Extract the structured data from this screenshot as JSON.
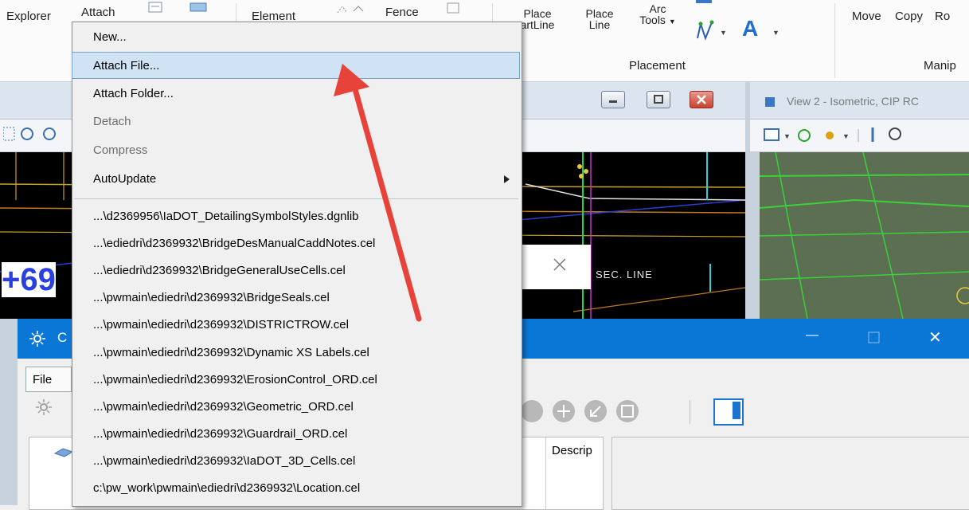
{
  "ribbon": {
    "explorer_label": "Explorer",
    "attach_label": "Attach",
    "element_label": "Element",
    "fence_label": "Fence",
    "place_smartline_top": "Place",
    "place_smartline_bottom": "artLine",
    "place_line_top": "Place",
    "place_line_bottom": "Line",
    "arc_tools_top": "Arc",
    "arc_tools_bottom": "Tools",
    "text_icon_label": "A",
    "move_label": "Move",
    "copy_label": "Copy",
    "rotate_label": "Ro",
    "placement_group": "Placement",
    "manipulate_group": "Manip"
  },
  "view1": {
    "section_line_text": "SEC. LINE",
    "station_text": "+69"
  },
  "view2": {
    "title": "View 2 - Isometric, CIP RC"
  },
  "dialog": {
    "title_fragment": "C",
    "menu_file": "File",
    "column_description": "Descrip",
    "minimize_glyph": "—",
    "close_glyph": "✕"
  },
  "menu": {
    "items": [
      {
        "label": "New...",
        "disabled": false
      },
      {
        "label": "Attach File...",
        "disabled": false
      },
      {
        "label": "Attach Folder...",
        "disabled": false
      },
      {
        "label": "Detach",
        "disabled": true
      },
      {
        "label": "Compress",
        "disabled": true
      },
      {
        "label": "AutoUpdate",
        "disabled": false
      }
    ],
    "recent_files": [
      "...\\d2369956\\IaDOT_DetailingSymbolStyles.dgnlib",
      "...\\ediedri\\d2369932\\BridgeDesManualCaddNotes.cel",
      "...\\ediedri\\d2369932\\BridgeGeneralUseCells.cel",
      "...\\pwmain\\ediedri\\d2369932\\BridgeSeals.cel",
      "...\\pwmain\\ediedri\\d2369932\\DISTRICTROW.cel",
      "...\\pwmain\\ediedri\\d2369932\\Dynamic XS Labels.cel",
      "...\\pwmain\\ediedri\\d2369932\\ErosionControl_ORD.cel",
      "...\\pwmain\\ediedri\\d2369932\\Geometric_ORD.cel",
      "...\\pwmain\\ediedri\\d2369932\\Guardrail_ORD.cel",
      "...\\pwmain\\ediedri\\d2369932\\IaDOT_3D_Cells.cel",
      "c:\\pw_work\\pwmain\\ediedri\\d2369932\\Location.cel"
    ]
  },
  "colors": {
    "menu_highlight": "#cfe3f4",
    "annotation_arrow": "#e8433a",
    "dialog_title": "#0a76d6"
  }
}
